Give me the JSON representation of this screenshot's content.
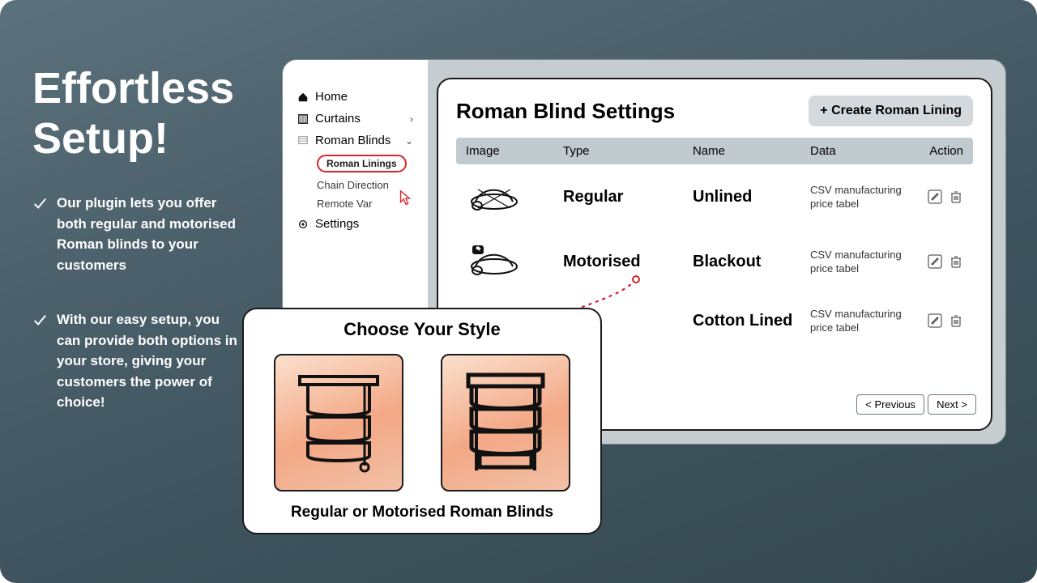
{
  "headline_l1": "Effortless",
  "headline_l2": "Setup!",
  "bullets": [
    "Our plugin lets you offer both regular and motorised Roman blinds to your customers",
    "With our easy setup, you can provide both options in your store, giving your customers the power of choice!"
  ],
  "sidebar": {
    "home": "Home",
    "curtains": "Curtains",
    "roman_blinds": "Roman Blinds",
    "sub_roman_linings": "Roman Linings",
    "sub_chain": "Chain Direction",
    "sub_remote": "Remote Var",
    "settings": "Settings"
  },
  "panel": {
    "title": "Roman Blind Settings",
    "create_label": "+ Create Roman Lining",
    "columns": {
      "image": "Image",
      "type": "Type",
      "name": "Name",
      "data": "Data",
      "action": "Action"
    },
    "rows": [
      {
        "type": "Regular",
        "name": "Unlined",
        "data": "CSV manufacturing price tabel",
        "thumb": "crossed"
      },
      {
        "type": "Motorised",
        "name": "Blackout",
        "data": "CSV manufacturing price tabel",
        "thumb": "motor"
      },
      {
        "type": "",
        "name": "Cotton Lined",
        "data": "CSV manufacturing price tabel",
        "thumb": "none"
      }
    ],
    "prev": "< Previous",
    "next": "Next >"
  },
  "popup": {
    "title": "Choose Your Style",
    "caption": "Regular or Motorised Roman Blinds"
  }
}
